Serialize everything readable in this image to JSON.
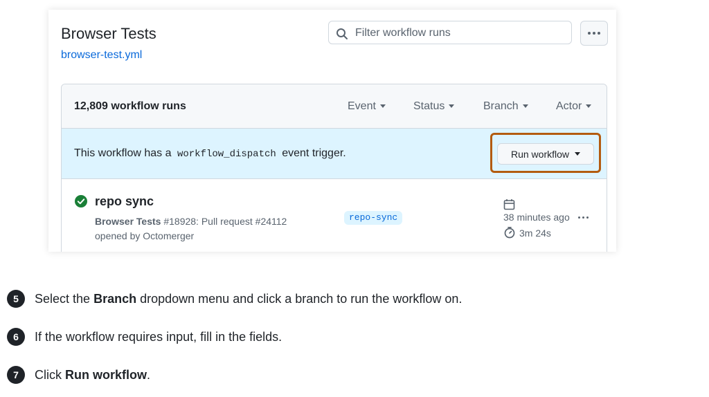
{
  "workflow": {
    "title": "Browser Tests",
    "file_link": "browser-test.yml",
    "filter_placeholder": "Filter workflow runs",
    "more_icon": "kebab-horizontal-icon"
  },
  "runs_header": {
    "count": "12,809 workflow runs",
    "filters": [
      "Event",
      "Status",
      "Branch",
      "Actor"
    ]
  },
  "dispatch_banner": {
    "text_before": "This workflow has a",
    "code": "workflow_dispatch",
    "text_after": "event trigger.",
    "run_button": "Run workflow",
    "highlight_color": "#b35b0f"
  },
  "run": {
    "title": "repo sync",
    "workflow_name": "Browser Tests",
    "detail": "#18928: Pull request #24112",
    "opened_by": "opened by Octomerger",
    "branch": "repo-sync",
    "time_ago": "38 minutes ago",
    "duration": "3m 24s",
    "status_color": "#1a7f37"
  },
  "steps": [
    {
      "number": "5",
      "before": "Select the",
      "bold": "Branch",
      "after": "dropdown menu and click a branch to run the workflow on."
    },
    {
      "number": "6",
      "before": "If the workflow requires input, fill in the fields.",
      "bold": "",
      "after": ""
    },
    {
      "number": "7",
      "before": "Click",
      "bold": "Run workflow",
      "after": "."
    }
  ]
}
